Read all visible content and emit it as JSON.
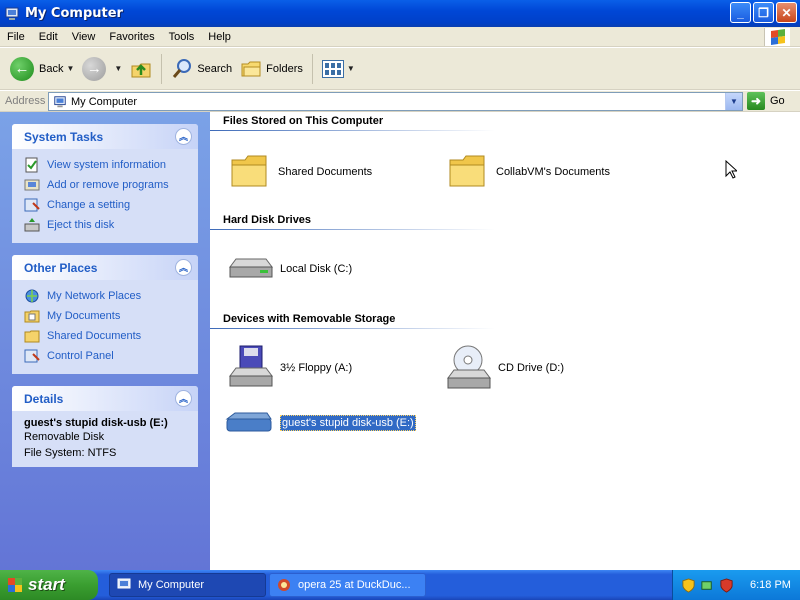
{
  "window": {
    "title": "My Computer"
  },
  "menu": [
    "File",
    "Edit",
    "View",
    "Favorites",
    "Tools",
    "Help"
  ],
  "toolbar": {
    "back": "Back",
    "search": "Search",
    "folders": "Folders"
  },
  "address": {
    "label": "Address",
    "value": "My Computer",
    "go": "Go"
  },
  "system_tasks": {
    "title": "System Tasks",
    "items": [
      "View system information",
      "Add or remove programs",
      "Change a setting",
      "Eject this disk"
    ]
  },
  "other_places": {
    "title": "Other Places",
    "items": [
      "My Network Places",
      "My Documents",
      "Shared Documents",
      "Control Panel"
    ]
  },
  "details": {
    "title": "Details",
    "name": "guest's stupid disk-usb (E:)",
    "type": "Removable Disk",
    "filesystem": "File System: NTFS"
  },
  "groups": {
    "files_stored": {
      "title": "Files Stored on This Computer",
      "items": [
        "Shared Documents",
        "CollabVM's Documents"
      ]
    },
    "hard_disks": {
      "title": "Hard Disk Drives",
      "items": [
        "Local Disk (C:)"
      ]
    },
    "removable": {
      "title": "Devices with Removable Storage",
      "items": [
        "3½ Floppy (A:)",
        "CD Drive (D:)",
        "guest's stupid disk-usb (E:)"
      ]
    }
  },
  "taskbar": {
    "start": "start",
    "tasks": [
      "My Computer",
      "opera 25 at DuckDuc..."
    ],
    "clock": "6:18 PM"
  },
  "colors": {
    "accent": "#215dc6",
    "titlebar": "#0047d6",
    "selection": "#316ac5"
  }
}
